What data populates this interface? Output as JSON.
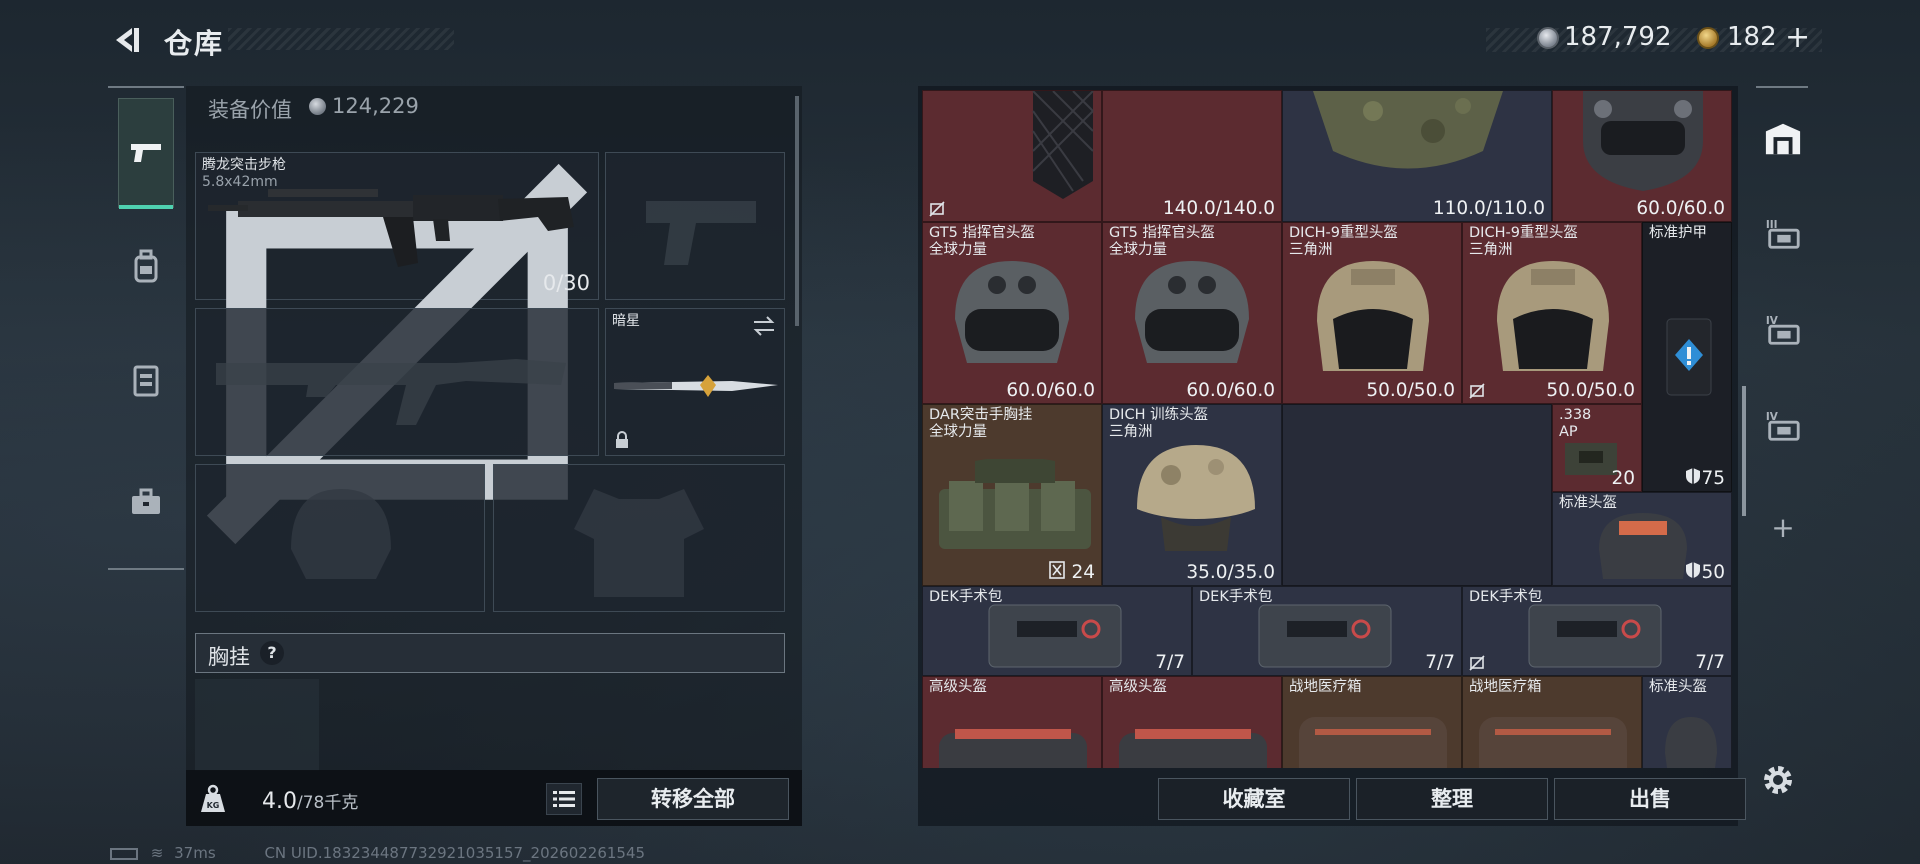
{
  "header": {
    "title": "仓库",
    "currency": "187,792",
    "premium": "182",
    "add_symbol": "+"
  },
  "left": {
    "equip_value_label": "装备价值",
    "equip_value": "124,229",
    "rifle": {
      "name": "腾龙突击步枪",
      "caliber": "5.8x42mm",
      "ammo": "0/30"
    },
    "knife": {
      "name": "暗星"
    },
    "chestrig_label": "胸挂",
    "help": "?",
    "weight": "4.0",
    "weight_unit": "/78千克",
    "transfer_all": "转移全部"
  },
  "grid": {
    "row1": {
      "c1_val": "140.0/140.0",
      "c2_val": "110.0/110.0",
      "c3_val": "60.0/60.0"
    },
    "row2": [
      {
        "name": "GT5 指挥官头盔",
        "sub": "全球力量",
        "val": "60.0/60.0"
      },
      {
        "name": "GT5 指挥官头盔",
        "sub": "全球力量",
        "val": "60.0/60.0"
      },
      {
        "name": "DICH-9重型头盔",
        "sub": "三角洲",
        "val": "50.0/50.0"
      },
      {
        "name": "DICH-9重型头盔",
        "sub": "三角洲",
        "val": "50.0/50.0"
      },
      {
        "name": "标准护甲",
        "val": "75"
      }
    ],
    "row3": [
      {
        "name": "DAR突击手胸挂",
        "sub": "全球力量",
        "val": "24"
      },
      {
        "name": "DICH 训练头盔",
        "sub": "三角洲",
        "val": "35.0/35.0"
      },
      {
        "name": ".338",
        "sub": "AP",
        "val": "20"
      },
      {
        "name": "标准头盔",
        "val": "50"
      }
    ],
    "row4": [
      {
        "name": "DEK手术包",
        "val": "7/7"
      },
      {
        "name": "DEK手术包",
        "val": "7/7"
      },
      {
        "name": "DEK手术包",
        "val": "7/7"
      }
    ],
    "row5": [
      {
        "name": "高级头盔"
      },
      {
        "name": "高级头盔"
      },
      {
        "name": "战地医疗箱"
      },
      {
        "name": "战地医疗箱"
      },
      {
        "name": "标准头盔"
      }
    ]
  },
  "buttons": {
    "collection": "收藏室",
    "sort": "整理",
    "sell": "出售"
  },
  "rail": {
    "tier3": "III",
    "tier4a": "IV",
    "tier4b": "IV",
    "plus": "+"
  },
  "status": {
    "ping": "37ms",
    "uid": "CN UID.183234487732921035157_202602261545"
  },
  "colors": {
    "accent": "#4fd1b0",
    "red_rarity": "#5c2b30",
    "blue_rarity": "#2e3344"
  }
}
